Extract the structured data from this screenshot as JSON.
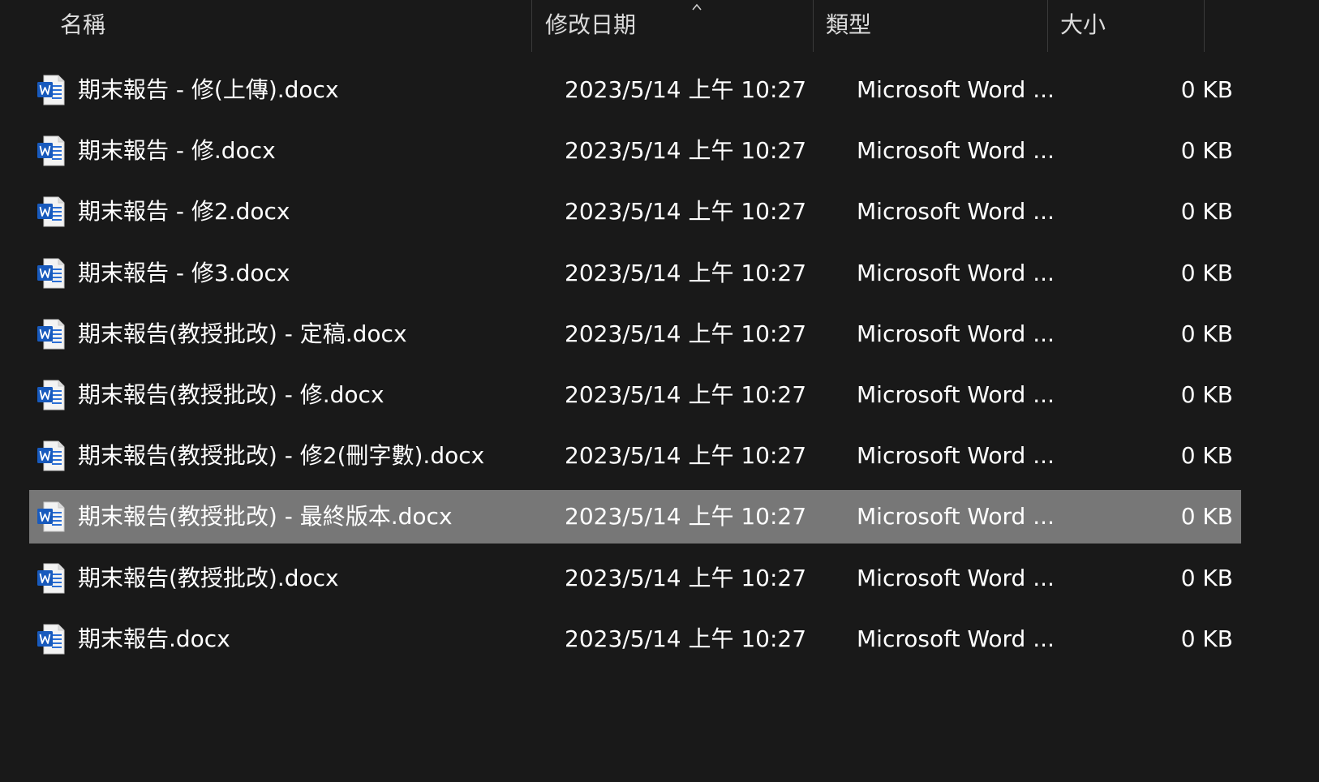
{
  "header": {
    "name_label": "名稱",
    "date_label": "修改日期",
    "type_label": "類型",
    "size_label": "大小",
    "sort_icon": "chevron-up-icon"
  },
  "colors": {
    "background": "#191919",
    "selected_row": "#777777",
    "word_blue": "#185abd",
    "header_text": "#dcdcdc"
  },
  "files": [
    {
      "name": "期末報告 - 修(上傳).docx",
      "date": "2023/5/14 上午 10:27",
      "type": "Microsoft Word ...",
      "size": "0 KB",
      "selected": false
    },
    {
      "name": "期末報告 - 修.docx",
      "date": "2023/5/14 上午 10:27",
      "type": "Microsoft Word ...",
      "size": "0 KB",
      "selected": false
    },
    {
      "name": "期末報告 - 修2.docx",
      "date": "2023/5/14 上午 10:27",
      "type": "Microsoft Word ...",
      "size": "0 KB",
      "selected": false
    },
    {
      "name": "期末報告 - 修3.docx",
      "date": "2023/5/14 上午 10:27",
      "type": "Microsoft Word ...",
      "size": "0 KB",
      "selected": false
    },
    {
      "name": "期末報告(教授批改) - 定稿.docx",
      "date": "2023/5/14 上午 10:27",
      "type": "Microsoft Word ...",
      "size": "0 KB",
      "selected": false
    },
    {
      "name": "期末報告(教授批改) - 修.docx",
      "date": "2023/5/14 上午 10:27",
      "type": "Microsoft Word ...",
      "size": "0 KB",
      "selected": false
    },
    {
      "name": "期末報告(教授批改) - 修2(刪字數).docx",
      "date": "2023/5/14 上午 10:27",
      "type": "Microsoft Word ...",
      "size": "0 KB",
      "selected": false
    },
    {
      "name": "期末報告(教授批改) - 最終版本.docx",
      "date": "2023/5/14 上午 10:27",
      "type": "Microsoft Word ...",
      "size": "0 KB",
      "selected": true
    },
    {
      "name": "期末報告(教授批改).docx",
      "date": "2023/5/14 上午 10:27",
      "type": "Microsoft Word ...",
      "size": "0 KB",
      "selected": false
    },
    {
      "name": "期末報告.docx",
      "date": "2023/5/14 上午 10:27",
      "type": "Microsoft Word ...",
      "size": "0 KB",
      "selected": false
    }
  ]
}
